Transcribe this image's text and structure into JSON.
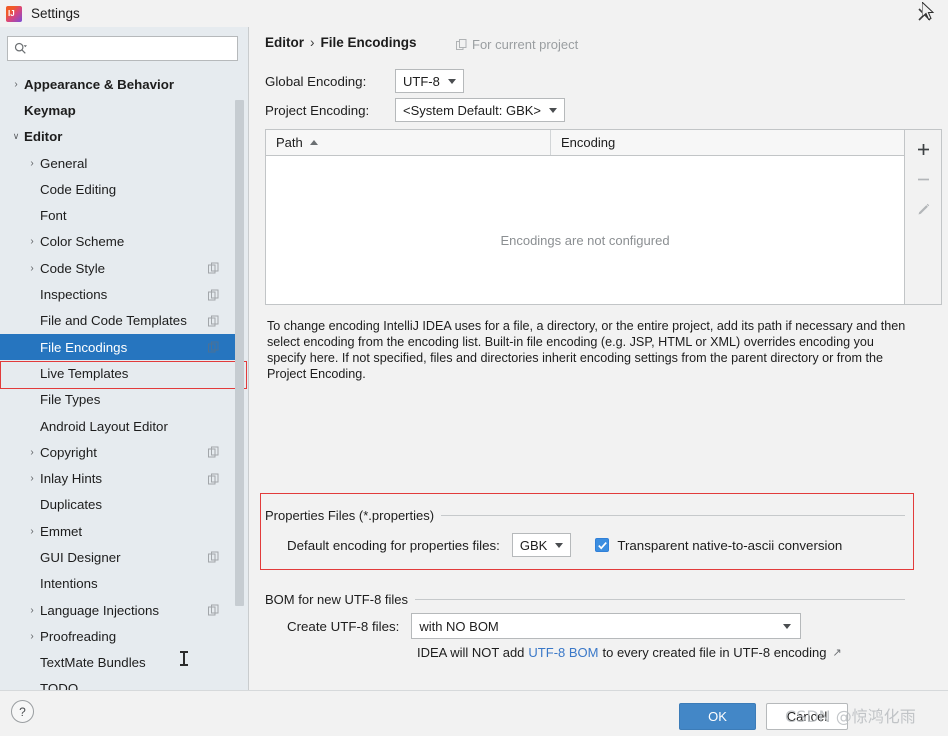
{
  "window": {
    "title": "Settings",
    "app_icon": "intellij-idea-icon",
    "close_icon": "close-icon"
  },
  "sidebar": {
    "search": {
      "placeholder": "",
      "value": "",
      "icon": "search-icon"
    },
    "items": [
      {
        "label": "Appearance & Behavior",
        "level": 1,
        "bold": true,
        "twisty": "chevron-right",
        "scope_icon": false
      },
      {
        "label": "Keymap",
        "level": 1,
        "bold": true,
        "twisty": "",
        "scope_icon": false
      },
      {
        "label": "Editor",
        "level": 1,
        "bold": true,
        "twisty": "chevron-down",
        "scope_icon": false
      },
      {
        "label": "General",
        "level": 2,
        "bold": false,
        "twisty": "chevron-right",
        "scope_icon": false
      },
      {
        "label": "Code Editing",
        "level": 2,
        "bold": false,
        "twisty": "",
        "scope_icon": false
      },
      {
        "label": "Font",
        "level": 2,
        "bold": false,
        "twisty": "",
        "scope_icon": false
      },
      {
        "label": "Color Scheme",
        "level": 2,
        "bold": false,
        "twisty": "chevron-right",
        "scope_icon": false
      },
      {
        "label": "Code Style",
        "level": 2,
        "bold": false,
        "twisty": "chevron-right",
        "scope_icon": true
      },
      {
        "label": "Inspections",
        "level": 2,
        "bold": false,
        "twisty": "",
        "scope_icon": true
      },
      {
        "label": "File and Code Templates",
        "level": 2,
        "bold": false,
        "twisty": "",
        "scope_icon": true
      },
      {
        "label": "File Encodings",
        "level": 2,
        "bold": false,
        "twisty": "",
        "scope_icon": true,
        "selected": true
      },
      {
        "label": "Live Templates",
        "level": 2,
        "bold": false,
        "twisty": "",
        "scope_icon": false
      },
      {
        "label": "File Types",
        "level": 2,
        "bold": false,
        "twisty": "",
        "scope_icon": false
      },
      {
        "label": "Android Layout Editor",
        "level": 2,
        "bold": false,
        "twisty": "",
        "scope_icon": false
      },
      {
        "label": "Copyright",
        "level": 2,
        "bold": false,
        "twisty": "chevron-right",
        "scope_icon": true
      },
      {
        "label": "Inlay Hints",
        "level": 2,
        "bold": false,
        "twisty": "chevron-right",
        "scope_icon": true
      },
      {
        "label": "Duplicates",
        "level": 2,
        "bold": false,
        "twisty": "",
        "scope_icon": false
      },
      {
        "label": "Emmet",
        "level": 2,
        "bold": false,
        "twisty": "chevron-right",
        "scope_icon": false
      },
      {
        "label": "GUI Designer",
        "level": 2,
        "bold": false,
        "twisty": "",
        "scope_icon": true
      },
      {
        "label": "Intentions",
        "level": 2,
        "bold": false,
        "twisty": "",
        "scope_icon": false
      },
      {
        "label": "Language Injections",
        "level": 2,
        "bold": false,
        "twisty": "chevron-right",
        "scope_icon": true
      },
      {
        "label": "Proofreading",
        "level": 2,
        "bold": false,
        "twisty": "chevron-right",
        "scope_icon": false
      },
      {
        "label": "TextMate Bundles",
        "level": 2,
        "bold": false,
        "twisty": "",
        "scope_icon": false
      },
      {
        "label": "TODO",
        "level": 2,
        "bold": false,
        "twisty": "",
        "scope_icon": false
      }
    ],
    "selection_color": "#2675bf",
    "highlight_color": "#e23b3b"
  },
  "main": {
    "breadcrumb": {
      "parent": "Editor",
      "separator": "›",
      "current": "File Encodings"
    },
    "for_current_project": "For current project",
    "global_encoding": {
      "label": "Global Encoding:",
      "value": "UTF-8"
    },
    "project_encoding": {
      "label": "Project Encoding:",
      "value": "<System Default: GBK>"
    },
    "table": {
      "columns": [
        "Path",
        "Encoding"
      ],
      "sort_column": "Path",
      "sort_direction": "ascending",
      "rows": [],
      "empty_message": "Encodings are not configured",
      "tools": [
        {
          "name": "add-encoding-button",
          "glyph": "+",
          "enabled": true
        },
        {
          "name": "remove-encoding-button",
          "glyph": "−",
          "enabled": false
        },
        {
          "name": "edit-encoding-button",
          "glyph": "pencil",
          "enabled": false
        }
      ]
    },
    "description": "To change encoding IntelliJ IDEA uses for a file, a directory, or the entire project, add its path if necessary and then select encoding from the encoding list. Built-in file encoding (e.g. JSP, HTML or XML) overrides encoding you specify here. If not specified, files and directories inherit encoding settings from the parent directory or from the Project Encoding.",
    "properties_group": {
      "title": "Properties Files (*.properties)",
      "default_encoding_label": "Default encoding for properties files:",
      "default_encoding_value": "GBK",
      "transparent_checkbox_label": "Transparent native-to-ascii conversion",
      "transparent_checked": true
    },
    "bom_group": {
      "title": "BOM for new UTF-8 files",
      "create_label": "Create UTF-8 files:",
      "create_value": "with NO BOM",
      "note_prefix": "IDEA will NOT add",
      "note_link": "UTF-8 BOM",
      "note_suffix": "to every created file in UTF-8 encoding"
    }
  },
  "footer": {
    "help_label": "?",
    "ok_label": "OK",
    "cancel_label": "Cancel",
    "watermark": "CSDN @惊鸿化雨"
  }
}
